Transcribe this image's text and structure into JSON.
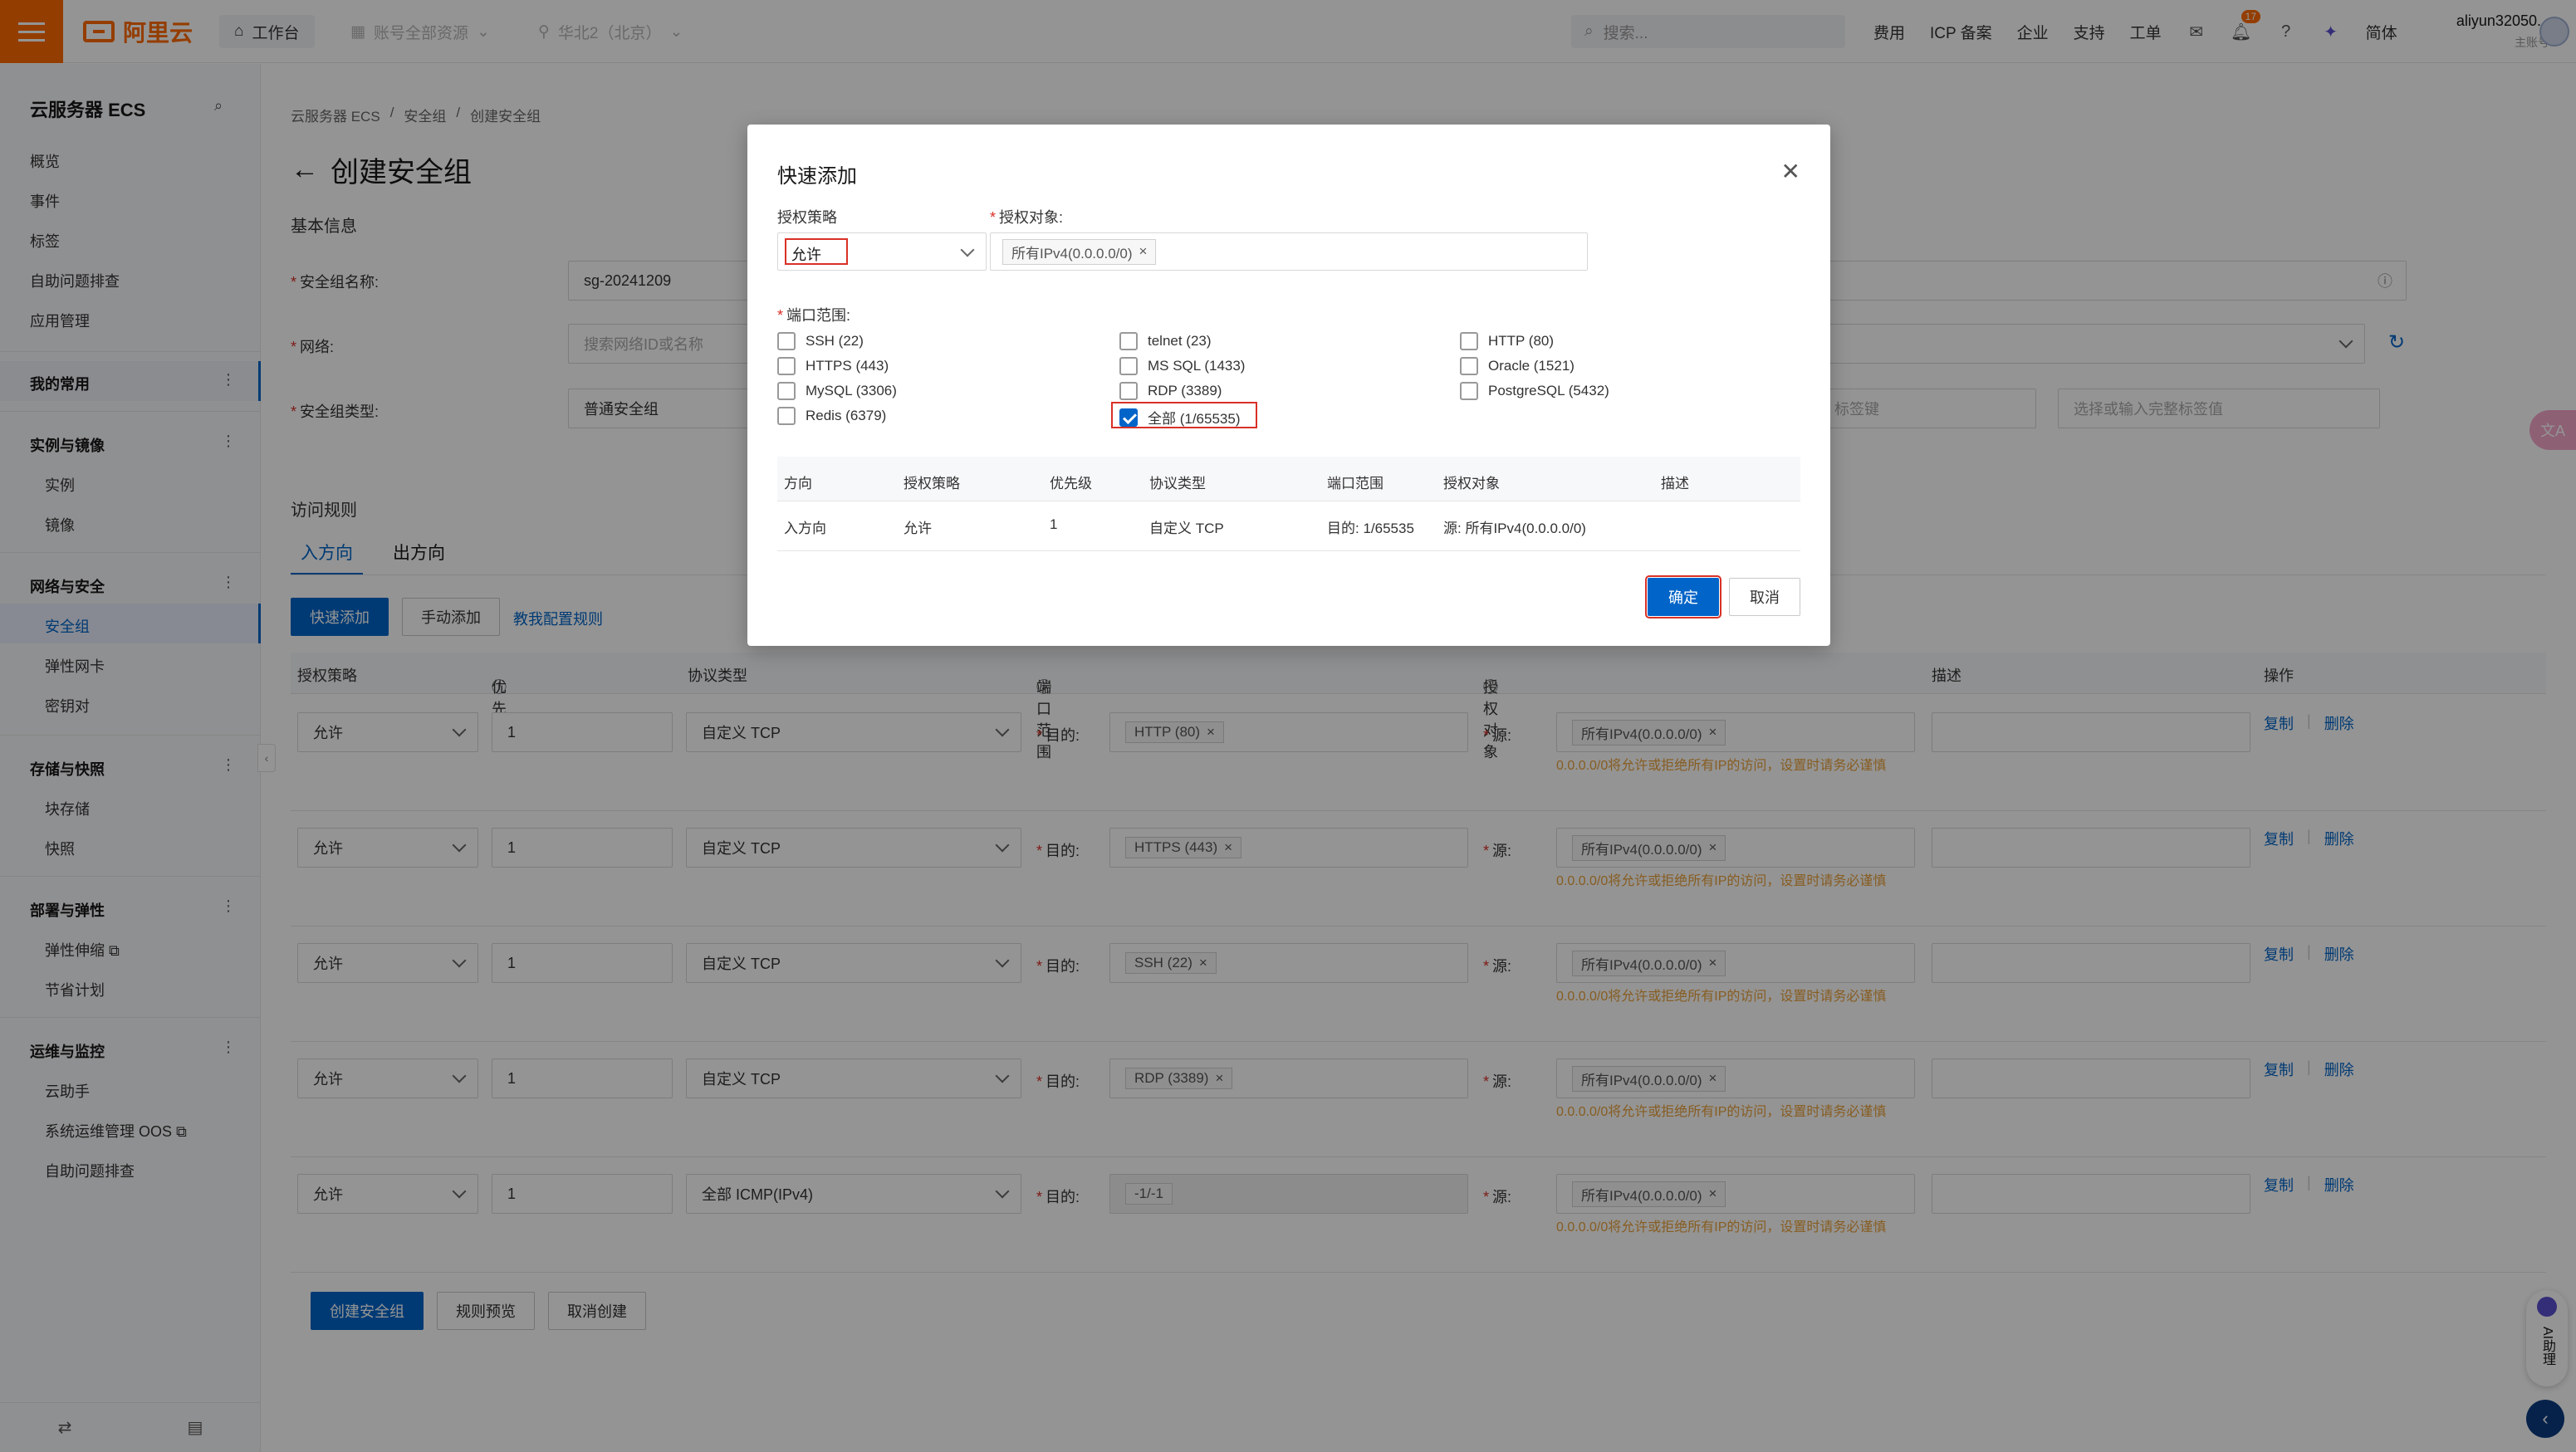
{
  "topbar": {
    "logo_text": "阿里云",
    "workbench": "工作台",
    "account_scope": "账号全部资源",
    "region": "华北2（北京）",
    "search_placeholder": "搜索...",
    "links": [
      "费用",
      "ICP 备案",
      "企业",
      "支持",
      "工单"
    ],
    "notification_count": "17",
    "language": "简体",
    "username": "aliyun32050...",
    "account_type": "主账号"
  },
  "sidebar": {
    "title": "云服务器 ECS",
    "top_items": [
      "概览",
      "事件",
      "标签",
      "自助问题排查",
      "应用管理"
    ],
    "favorites": "我的常用",
    "groups": [
      {
        "label": "实例与镜像",
        "items": [
          "实例",
          "镜像"
        ]
      },
      {
        "label": "网络与安全",
        "items": [
          "安全组",
          "弹性网卡",
          "密钥对"
        ]
      },
      {
        "label": "存储与快照",
        "items": [
          "块存储",
          "快照"
        ]
      },
      {
        "label": "部署与弹性",
        "items": [
          "弹性伸缩",
          "节省计划"
        ]
      },
      {
        "label": "运维与监控",
        "items": [
          "云助手",
          "系统运维管理 OOS",
          "自助问题排查"
        ]
      }
    ]
  },
  "breadcrumb": [
    "云服务器 ECS",
    "/",
    "安全组",
    "/",
    "创建安全组"
  ],
  "page": {
    "title": "创建安全组",
    "basic_info": "基本信息",
    "name_label": "安全组名称:",
    "name_value": "sg-20241209",
    "network_label": "网络:",
    "network_placeholder": "搜索网络ID或名称",
    "type_label": "安全组类型:",
    "type_value": "普通安全组",
    "tag_key_placeholder": "标签键",
    "tag_value_placeholder": "选择或输入完整标签值",
    "rules_title": "访问规则",
    "tab_in": "入方向",
    "tab_out": "出方向",
    "quick_add": "快速添加",
    "manual_add": "手动添加",
    "teach_link": "教我配置规则",
    "columns": [
      "授权策略",
      "优先级",
      "协议类型",
      "端口范围",
      "授权对象",
      "描述",
      "操作"
    ],
    "dest_label": "目的:",
    "src_label": "源:",
    "warn_text": "0.0.0.0/0将允许或拒绝所有IP的访问，设置时请务必谨慎",
    "op_copy": "复制",
    "op_delete": "删除",
    "rules": [
      {
        "policy": "允许",
        "priority": "1",
        "protocol": "自定义 TCP",
        "port": "HTTP (80)",
        "source": "所有IPv4(0.0.0.0/0)"
      },
      {
        "policy": "允许",
        "priority": "1",
        "protocol": "自定义 TCP",
        "port": "HTTPS (443)",
        "source": "所有IPv4(0.0.0.0/0)"
      },
      {
        "policy": "允许",
        "priority": "1",
        "protocol": "自定义 TCP",
        "port": "SSH (22)",
        "source": "所有IPv4(0.0.0.0/0)"
      },
      {
        "policy": "允许",
        "priority": "1",
        "protocol": "自定义 TCP",
        "port": "RDP (3389)",
        "source": "所有IPv4(0.0.0.0/0)"
      },
      {
        "policy": "允许",
        "priority": "1",
        "protocol": "全部 ICMP(IPv4)",
        "port": "-1/-1",
        "source": "所有IPv4(0.0.0.0/0)"
      }
    ],
    "create_btn": "创建安全组",
    "preview_btn": "规则预览",
    "cancel_btn": "取消创建"
  },
  "modal": {
    "title": "快速添加",
    "policy_label": "授权策略",
    "policy_value": "允许",
    "target_label": "授权对象:",
    "target_tag": "所有IPv4(0.0.0.0/0)",
    "port_label": "端口范围:",
    "options": [
      {
        "label": "SSH (22)",
        "checked": false
      },
      {
        "label": "telnet (23)",
        "checked": false
      },
      {
        "label": "HTTP (80)",
        "checked": false
      },
      {
        "label": "HTTPS (443)",
        "checked": false
      },
      {
        "label": "MS SQL (1433)",
        "checked": false
      },
      {
        "label": "Oracle (1521)",
        "checked": false
      },
      {
        "label": "MySQL (3306)",
        "checked": false
      },
      {
        "label": "RDP (3389)",
        "checked": false
      },
      {
        "label": "PostgreSQL (5432)",
        "checked": false
      },
      {
        "label": "Redis (6379)",
        "checked": false
      },
      {
        "label": "全部 (1/65535)",
        "checked": true
      }
    ],
    "table_headers": [
      "方向",
      "授权策略",
      "优先级",
      "协议类型",
      "端口范围",
      "授权对象",
      "描述"
    ],
    "table_row": [
      "入方向",
      "允许",
      "1",
      "自定义 TCP",
      "目的: 1/65535",
      "源: 所有IPv4(0.0.0.0/0)",
      ""
    ],
    "ok": "确定",
    "cancel": "取消"
  },
  "floating": {
    "ai_label": "AI助理"
  }
}
